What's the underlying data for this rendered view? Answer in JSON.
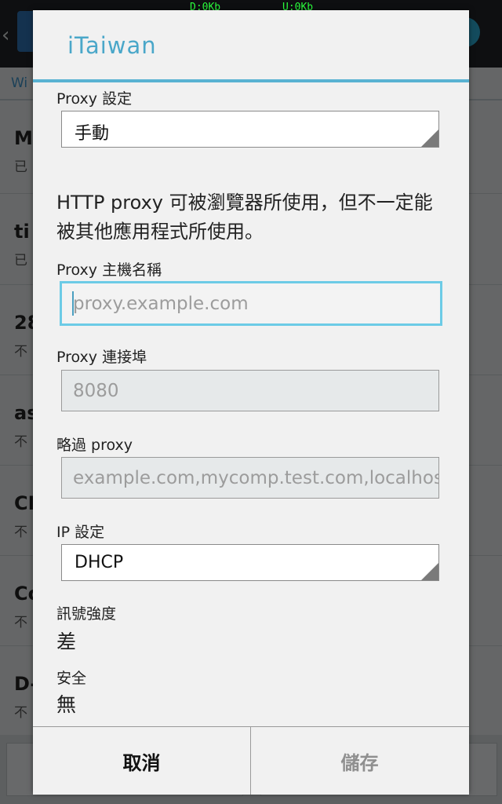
{
  "status_bar": {
    "download": "D:0Kb",
    "upload": "U:0Kb"
  },
  "background": {
    "tab_label": "Wi",
    "networks": [
      {
        "ssid": "My",
        "status": "已"
      },
      {
        "ssid": "ti",
        "status": "已"
      },
      {
        "ssid": "28",
        "status": "不"
      },
      {
        "ssid": "as",
        "status": "不"
      },
      {
        "ssid": "CH",
        "status": "不"
      },
      {
        "ssid": "Co",
        "status": "不"
      },
      {
        "ssid": "D-",
        "status": "不"
      }
    ]
  },
  "dialog": {
    "title": "iTaiwan",
    "proxy_setting_label": "Proxy 設定",
    "proxy_setting_value": "手動",
    "http_proxy_note": "HTTP proxy 可被瀏覽器所使用，但不一定能被其他應用程式所使用。",
    "hostname_label": "Proxy 主機名稱",
    "hostname_placeholder": "proxy.example.com",
    "port_label": "Proxy 連接埠",
    "port_placeholder": "8080",
    "bypass_label": "略過 proxy",
    "bypass_placeholder": "example.com,mycomp.test.com,localhost",
    "ip_setting_label": "IP 設定",
    "ip_setting_value": "DHCP",
    "signal_label": "訊號強度",
    "signal_value": "差",
    "security_label": "安全",
    "security_value": "無",
    "cancel_button": "取消",
    "save_button": "儲存"
  },
  "colors": {
    "accent": "#59b2d2",
    "focus_border": "#6ccbe6",
    "disabled_text": "#8f8f8f"
  }
}
